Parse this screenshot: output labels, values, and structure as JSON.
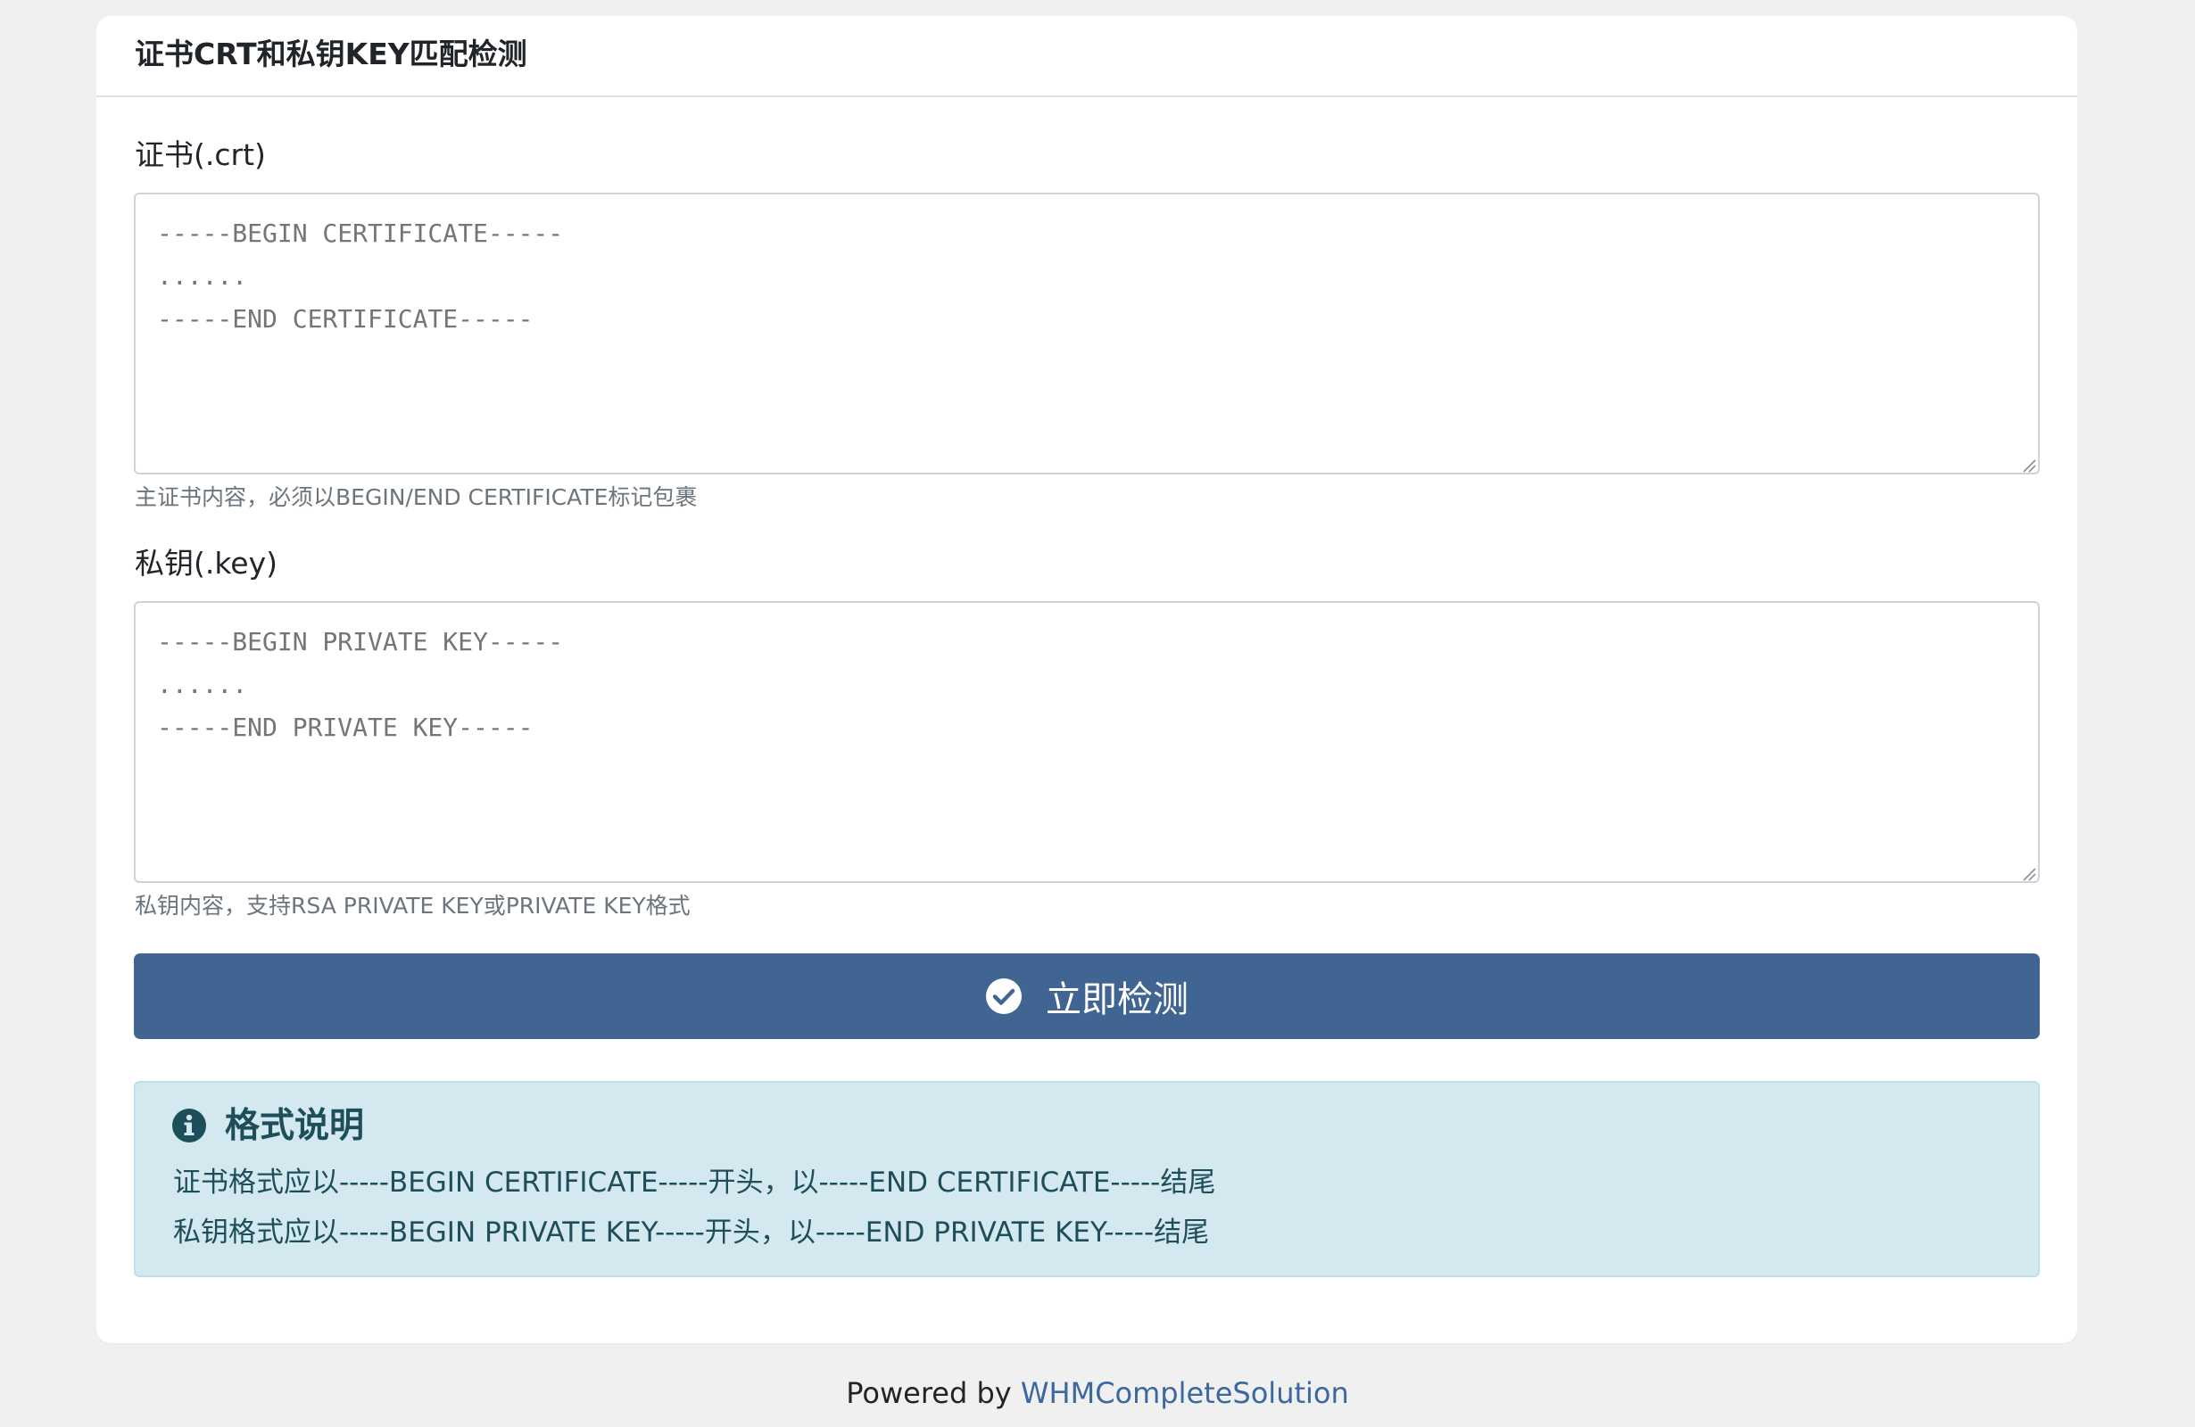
{
  "card": {
    "title": "证书CRT和私钥KEY匹配检测"
  },
  "certificate": {
    "label": "证书(.crt)",
    "placeholder": "-----BEGIN CERTIFICATE-----\n......\n-----END CERTIFICATE-----",
    "help": "主证书内容，必须以BEGIN/END CERTIFICATE标记包裹"
  },
  "private_key": {
    "label": "私钥(.key)",
    "placeholder": "-----BEGIN PRIVATE KEY-----\n......\n-----END PRIVATE KEY-----",
    "help": "私钥内容，支持RSA PRIVATE KEY或PRIVATE KEY格式"
  },
  "submit": {
    "label": "立即检测",
    "icon": "check-circle-icon"
  },
  "info": {
    "icon": "info-circle-icon",
    "title": "格式说明",
    "lines": [
      "证书格式应以-----BEGIN CERTIFICATE-----开头，以-----END CERTIFICATE-----结尾",
      "私钥格式应以-----BEGIN PRIVATE KEY-----开头，以-----END PRIVATE KEY-----结尾"
    ]
  },
  "footer": {
    "prefix": "Powered by",
    "link": "WHMCompleteSolution"
  },
  "colors": {
    "page_background": "#f0f0f0",
    "card_background": "#ffffff",
    "primary_button": "#416592",
    "info_background": "#d4e9ef",
    "info_text": "#1d4e5a",
    "link": "#3b68a0"
  }
}
